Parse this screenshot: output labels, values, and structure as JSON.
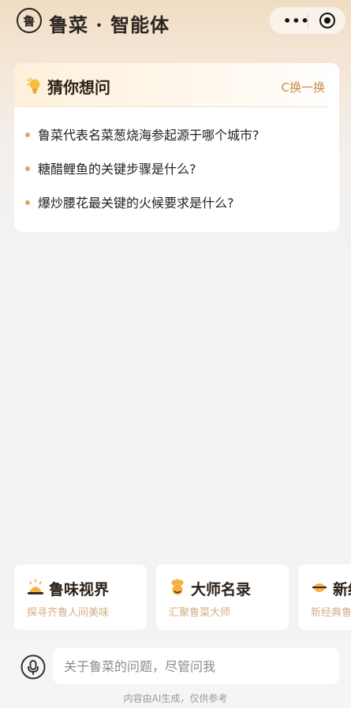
{
  "header": {
    "seal_char": "鲁",
    "brand": "鲁菜 · 智能体",
    "more_icon": "more-dots-icon",
    "close_icon": "target-icon"
  },
  "guess": {
    "title": "猜你想问",
    "refresh_label": "C换一换",
    "questions": [
      "鲁菜代表名菜葱烧海参起源于哪个城市?",
      "糖醋鲤鱼的关键步骤是什么?",
      "爆炒腰花最关键的火候要求是什么?"
    ]
  },
  "categories": [
    {
      "title": "鲁味视界",
      "subtitle": "探寻齐鲁人间美味",
      "icon": "bell-cloche-icon"
    },
    {
      "title": "大师名录",
      "subtitle": "汇聚鲁菜大师",
      "icon": "chef-icon"
    },
    {
      "title": "新经典",
      "subtitle": "新经典鲁菜",
      "icon": "bowl-icon"
    }
  ],
  "input": {
    "placeholder": "关于鲁菜的问题，尽管问我"
  },
  "disclaimer": "内容由AI生成，仅供参考",
  "colors": {
    "accent": "#e3a55a",
    "subtitle": "#d4ad84",
    "refresh": "#c58a4a"
  }
}
